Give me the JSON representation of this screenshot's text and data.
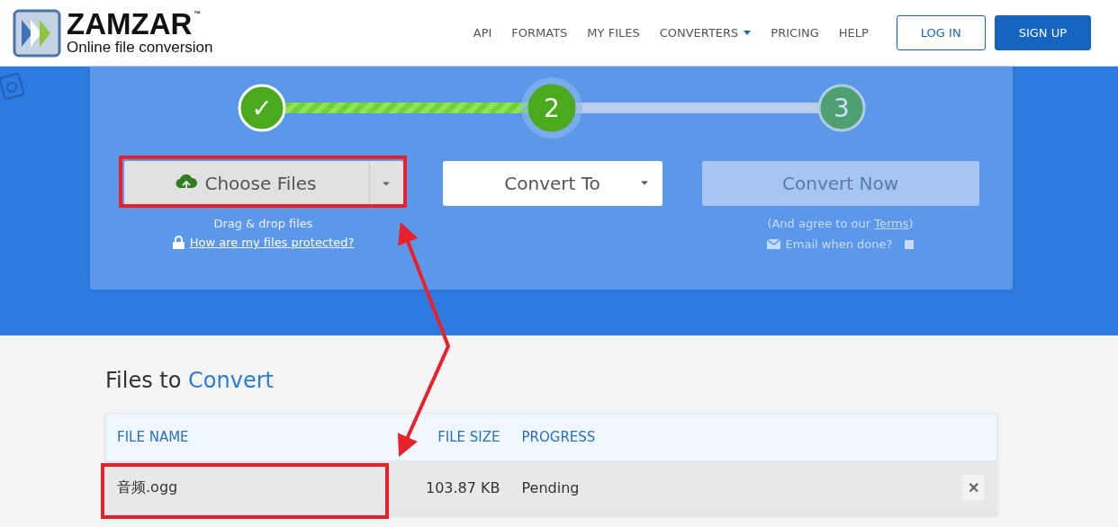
{
  "logo": {
    "name": "ZAMZAR",
    "trademark": "™",
    "tagline": "Online file conversion"
  },
  "nav": [
    {
      "label": "API",
      "dropdown": false
    },
    {
      "label": "FORMATS",
      "dropdown": false
    },
    {
      "label": "MY FILES",
      "dropdown": false
    },
    {
      "label": "CONVERTERS",
      "dropdown": true
    },
    {
      "label": "PRICING",
      "dropdown": false
    },
    {
      "label": "HELP",
      "dropdown": false
    }
  ],
  "auth_buttons": [
    {
      "label": "LOG IN",
      "kind": "outline"
    },
    {
      "label": "SIGN UP",
      "kind": "filled"
    }
  ],
  "steps": [
    {
      "label": "✓",
      "kind": "done"
    },
    {
      "label": "2",
      "kind": "active"
    },
    {
      "label": "3",
      "kind": "pending"
    }
  ],
  "choose_files": {
    "label": "Choose Files",
    "hint": "Drag & drop files",
    "protect_link": "How are my files protected?"
  },
  "convert_to": {
    "label": "Convert To"
  },
  "convert_now": {
    "label": "Convert Now",
    "disabled": true,
    "terms_before": "(And agree to our ",
    "terms_link": "Terms",
    "terms_after": ")",
    "email_label": "Email when done?",
    "email_checked": false
  },
  "files": {
    "title_plain": "Files to",
    "title_accent": "Convert",
    "columns": [
      "FILE NAME",
      "FILE SIZE",
      "PROGRESS"
    ],
    "rows": [
      {
        "name": "音频.ogg",
        "size": "103.87 KB",
        "progress": "Pending",
        "remove": "✕"
      }
    ]
  }
}
